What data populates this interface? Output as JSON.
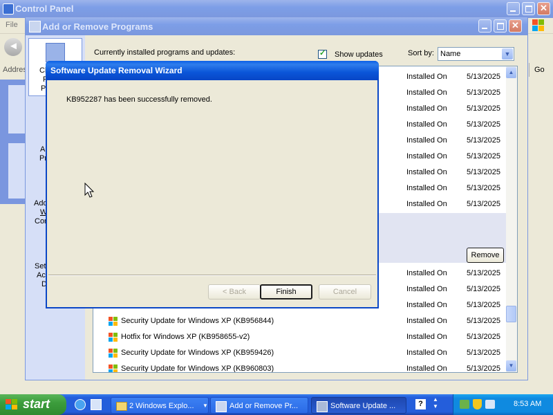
{
  "control_panel": {
    "title": "Control Panel",
    "menu_file": "File",
    "address_label": "Addres",
    "go_label": "Go"
  },
  "arp": {
    "title": "Add or Remove Programs",
    "sidebar_fragments": [
      "Ch",
      "R",
      "Pr",
      "A",
      "Pr",
      "Add",
      "W",
      "Com",
      "Set",
      "Acc",
      "D"
    ],
    "header": {
      "installed_label": "Currently installed programs and updates:",
      "show_updates_label": "Show updates",
      "show_updates_checked": true,
      "sort_by_label": "Sort by:",
      "sort_by_value": "Name"
    },
    "rows": [
      {
        "name": "",
        "status": "Installed On",
        "date": "5/13/2025"
      },
      {
        "name": "",
        "status": "Installed On",
        "date": "5/13/2025"
      },
      {
        "name": "",
        "status": "Installed On",
        "date": "5/13/2025"
      },
      {
        "name": "",
        "status": "Installed On",
        "date": "5/13/2025"
      },
      {
        "name": "",
        "status": "Installed On",
        "date": "5/13/2025"
      },
      {
        "name": "",
        "status": "Installed On",
        "date": "5/13/2025"
      },
      {
        "name": "",
        "status": "Installed On",
        "date": "5/13/2025"
      },
      {
        "name": "",
        "status": "Installed On",
        "date": "5/13/2025"
      },
      {
        "name": "",
        "status": "Installed On",
        "date": "5/13/2025"
      },
      {
        "name": "",
        "status": "Installed On",
        "date": "5/13/2025"
      }
    ],
    "remove_button": "Remove",
    "rows_below": [
      {
        "name": "",
        "status": "Installed On",
        "date": "5/13/2025"
      },
      {
        "name": "",
        "status": "Installed On",
        "date": "5/13/2025"
      },
      {
        "name": "",
        "status": "Installed On",
        "date": "5/13/2025"
      },
      {
        "name": "Security Update for Windows XP (KB956844)",
        "status": "Installed On",
        "date": "5/13/2025"
      },
      {
        "name": "Hotfix for Windows XP (KB958655-v2)",
        "status": "Installed On",
        "date": "5/13/2025"
      },
      {
        "name": "Security Update for Windows XP (KB959426)",
        "status": "Installed On",
        "date": "5/13/2025"
      },
      {
        "name": "Security Update for Windows XP (KB960803)",
        "status": "Installed On",
        "date": "5/13/2025"
      }
    ]
  },
  "wizard": {
    "title": "Software Update Removal Wizard",
    "message": "KB952287 has been successfully removed.",
    "back_button": "< Back",
    "finish_button": "Finish",
    "cancel_button": "Cancel"
  },
  "taskbar": {
    "start_label": "start",
    "tasks": [
      {
        "label": "2 Windows Explo...",
        "icon": "folder-icon"
      },
      {
        "label": "Add or Remove Pr...",
        "icon": "add-remove-icon"
      },
      {
        "label": "Software Update ...",
        "icon": "software-update-icon"
      }
    ],
    "clock": "8:53 AM"
  },
  "colors": {
    "xp_blue": "#0a55d8",
    "dialog_face": "#ece9d8",
    "taskbar_blue": "#245edb",
    "start_green": "#3c9d3c"
  }
}
